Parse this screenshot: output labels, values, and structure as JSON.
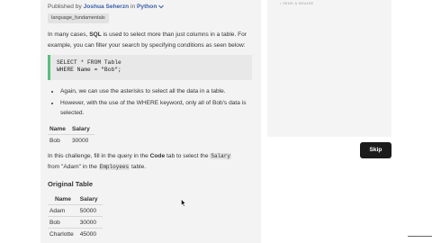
{
  "publisher": {
    "prefix": "Published by",
    "author": "Joshua Seherzn",
    "connector": "in",
    "language": "Python",
    "chevron": "chevron-down-icon"
  },
  "tag": "language_fundamentals",
  "intro": {
    "p1_before": "In many cases, ",
    "p1_bold": "SQL",
    "p1_after": " is used to select more than just columns in a table. For example, you can filter your search by specifying conditions as seen below:"
  },
  "code": {
    "line1": "SELECT * FROM Table",
    "line2": "WHERE Name = \"Bob\";"
  },
  "bullets": [
    "Again, we can use the asterisks to select all the data in a table.",
    "However, with the use of the WHERE keyword, only all of Bob's data is selected."
  ],
  "result_table": {
    "headers": [
      "Name",
      "Salary"
    ],
    "rows": [
      [
        "Bob",
        "30000"
      ]
    ]
  },
  "challenge": {
    "t1": "In this challenge, fill in the query in the ",
    "code_tab": "Code",
    "t2": " tab to select the ",
    "salary_code": "Salary",
    "t3": " from \"Adam\" in the ",
    "employees_code": "Employees",
    "t4": " table."
  },
  "original_table": {
    "heading": "Original Table",
    "headers": [
      "Name",
      "Salary"
    ],
    "rows": [
      [
        "Adam",
        "50000"
      ],
      [
        "Bob",
        "30000"
      ],
      [
        "Charlotte",
        "45000"
      ]
    ]
  },
  "panel": {
    "text": "• SEND & BRAINE"
  },
  "skip_label": "Skip",
  "colors": {
    "accent_green": "#58c07c",
    "link_blue": "#3a5fa8",
    "skip_bg": "#1b1b1b"
  }
}
